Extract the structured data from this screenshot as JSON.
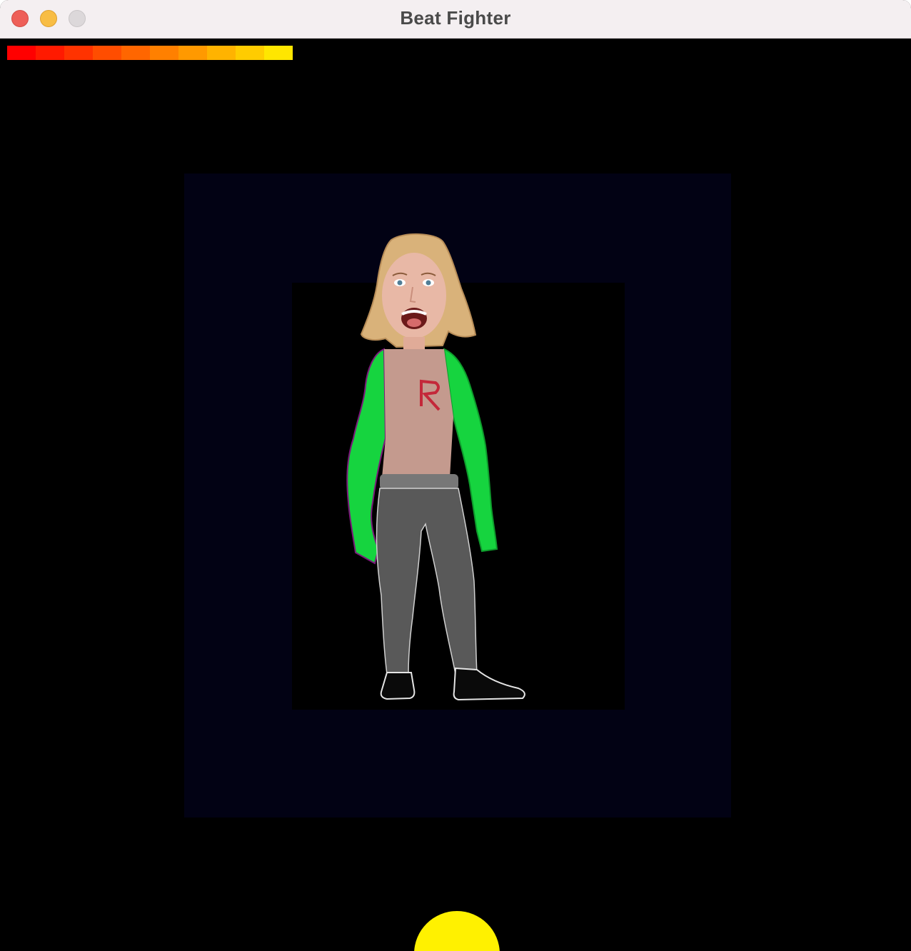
{
  "window": {
    "title": "Beat Fighter",
    "controls": [
      "close",
      "minimize",
      "zoom"
    ]
  },
  "health_bar": {
    "level": 1.0,
    "segment_colors": [
      "#ff0000",
      "#ff1a00",
      "#ff3300",
      "#ff4d00",
      "#ff6600",
      "#ff8000",
      "#ff9900",
      "#ffb300",
      "#ffcc00",
      "#ffe600"
    ]
  },
  "fighter": {
    "icon": "fighter-character-sprite",
    "colors": {
      "hair": "#d9b27a",
      "skin": "#e8b8a6",
      "shirt": "#c49a8e",
      "sleeves": "#16d43f",
      "pants": "#595959",
      "shoes": "#0a0a0a",
      "logo": "#c4283a"
    }
  },
  "beat_orb": {
    "icon": "beat-orb",
    "color": "#fff100"
  },
  "colors": {
    "background": "#000000",
    "stage_outer": "#020214",
    "stage_inner": "#000000"
  }
}
